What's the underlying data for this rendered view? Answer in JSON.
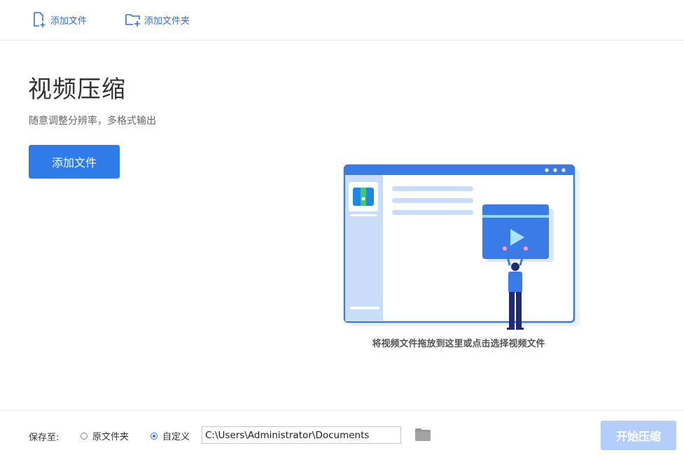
{
  "toolbar": {
    "add_file_label": "添加文件",
    "add_folder_label": "添加文件夹"
  },
  "main": {
    "title": "视频压缩",
    "subtitle": "随意调整分辨率，多格式输出",
    "add_file_button": "添加文件",
    "drop_hint": "将视频文件拖放到这里或点击选择视频文件"
  },
  "footer": {
    "save_to_label": "保存至:",
    "option_original": "原文件夹",
    "option_custom": "自定义",
    "selected_option": "custom",
    "output_path": "C:\\Users\\Administrator\\Documents",
    "start_button": "开始压缩"
  },
  "icons": {
    "add_file": "add-file-icon",
    "add_folder": "add-folder-icon",
    "browse": "folder-icon",
    "archive": "archive-icon",
    "play": "play-icon"
  },
  "colors": {
    "accent": "#2f7bea",
    "accent_disabled": "#b3cefa",
    "toolbar_text": "#2f6fe0"
  }
}
